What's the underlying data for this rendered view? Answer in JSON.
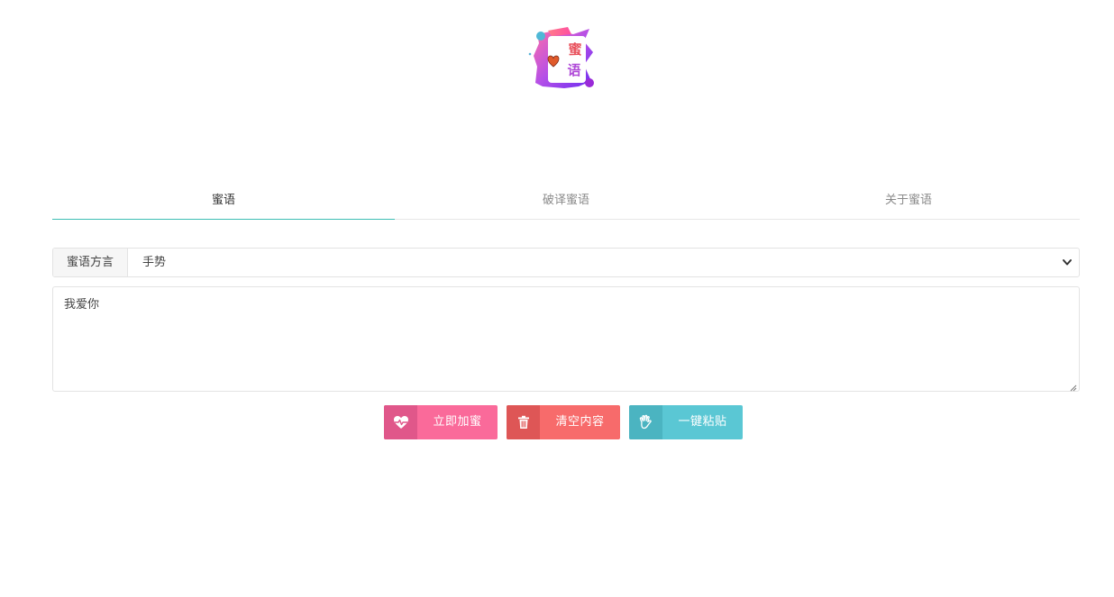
{
  "logo": {
    "text_top": "蜜",
    "text_bottom": "语",
    "icon": "heart-icon"
  },
  "tabs": [
    {
      "label": "蜜语",
      "active": true
    },
    {
      "label": "破译蜜语",
      "active": false
    },
    {
      "label": "关于蜜语",
      "active": false
    }
  ],
  "dialect": {
    "label": "蜜语方言",
    "selected": "手势",
    "icon": "chevron-down-icon"
  },
  "input": {
    "value": "我爱你"
  },
  "buttons": {
    "encrypt": {
      "label": "立即加蜜",
      "icon": "heartbeat-icon",
      "color": "#fa6a9a"
    },
    "clear": {
      "label": "清空内容",
      "icon": "trash-icon",
      "color": "#f76b6b"
    },
    "paste": {
      "label": "一键粘贴",
      "icon": "hand-icon",
      "color": "#5ac7d4"
    }
  },
  "colors": {
    "tab_active_underline": "#3dbeb4"
  }
}
